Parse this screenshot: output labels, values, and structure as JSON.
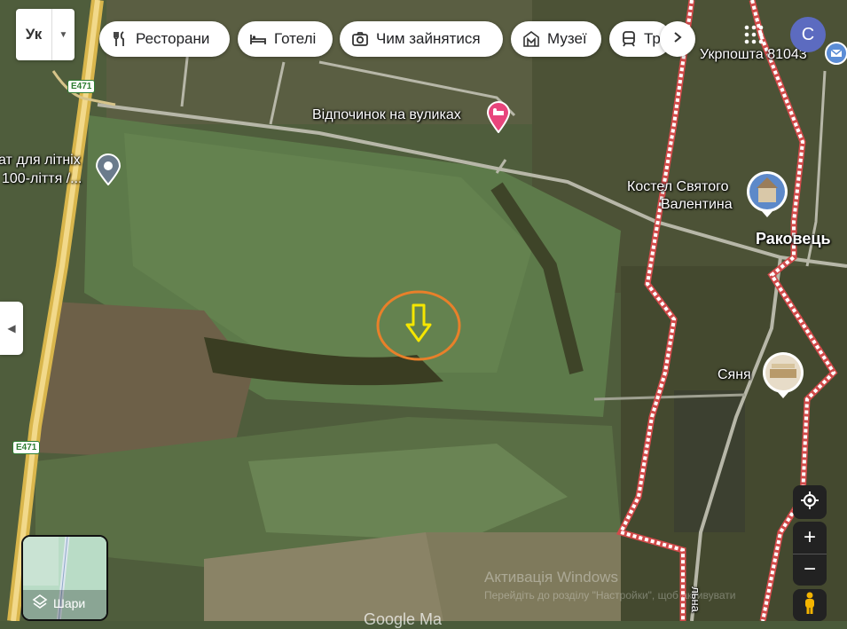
{
  "toolbar": {
    "language": "Ук",
    "chips": [
      {
        "label": "Ресторани",
        "icon": "fork-knife-icon"
      },
      {
        "label": "Готелі",
        "icon": "bed-icon"
      },
      {
        "label": "Чим зайнятися",
        "icon": "camera-icon"
      },
      {
        "label": "Музеї",
        "icon": "museum-icon"
      },
      {
        "label": "Тр",
        "icon": "train-icon"
      }
    ],
    "user_initial": "С"
  },
  "map": {
    "places": {
      "ukrposhta": "Укрпошта 81043",
      "apiary": "Відпочинок на вуликах",
      "left_place_line1": "ат для літніх",
      "left_place_line2": "100-ліття /...",
      "church_line1": "Костел Святого",
      "church_line2": "Валентина",
      "village": "Раковець",
      "syanya": "Сяня",
      "street_fragment": "льна"
    },
    "roads": {
      "shield_top": "E471",
      "shield_bottom": "E471"
    },
    "colors": {
      "boundary": "#e8a0a0",
      "marker_circle": "#e8802a",
      "marker_arrow": "#f5e600",
      "road": "#e9c46a"
    }
  },
  "layers": {
    "label": "Шари"
  },
  "watermark": {
    "line1": "Активація Windows",
    "line2": "Перейдіть до розділу \"Настройки\", щоб активувати",
    "logo_fragment": "Google Ma"
  }
}
